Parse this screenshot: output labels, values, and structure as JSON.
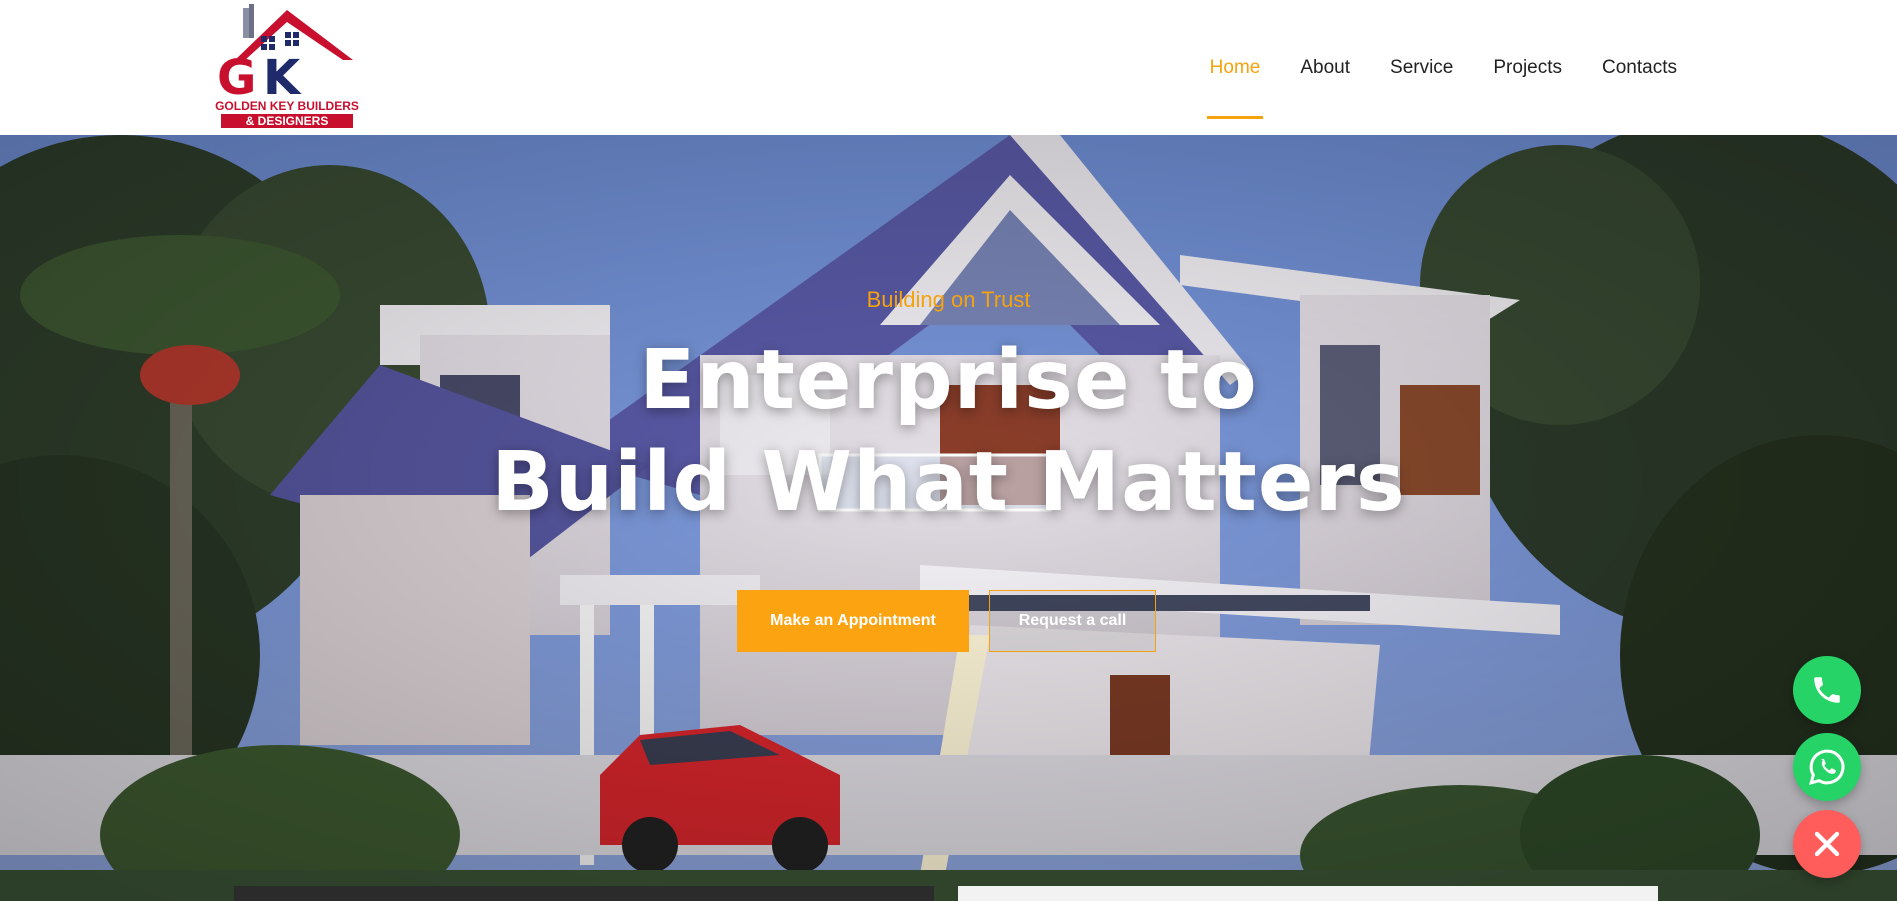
{
  "brand": {
    "logo_initials": "GK",
    "logo_line1": "GOLDEN KEY BUILDERS",
    "logo_line2": "& DESIGNERS",
    "colors": {
      "red": "#c8102e",
      "navy": "#1f2a6b"
    }
  },
  "nav": {
    "items": [
      {
        "label": "Home",
        "active": true
      },
      {
        "label": "About",
        "active": false
      },
      {
        "label": "Service",
        "active": false
      },
      {
        "label": "Projects",
        "active": false
      },
      {
        "label": "Contacts",
        "active": false
      }
    ],
    "accent": "#f5a20f"
  },
  "hero": {
    "tagline": "Building on Trust",
    "headline_line1": "Enterprise to",
    "headline_line2": "Build What Matters",
    "primary_button": "Make an Appointment",
    "secondary_button": "Request a call"
  },
  "floating_actions": {
    "phone_icon": "phone-icon",
    "whatsapp_icon": "whatsapp-icon",
    "close_icon": "close-icon"
  }
}
